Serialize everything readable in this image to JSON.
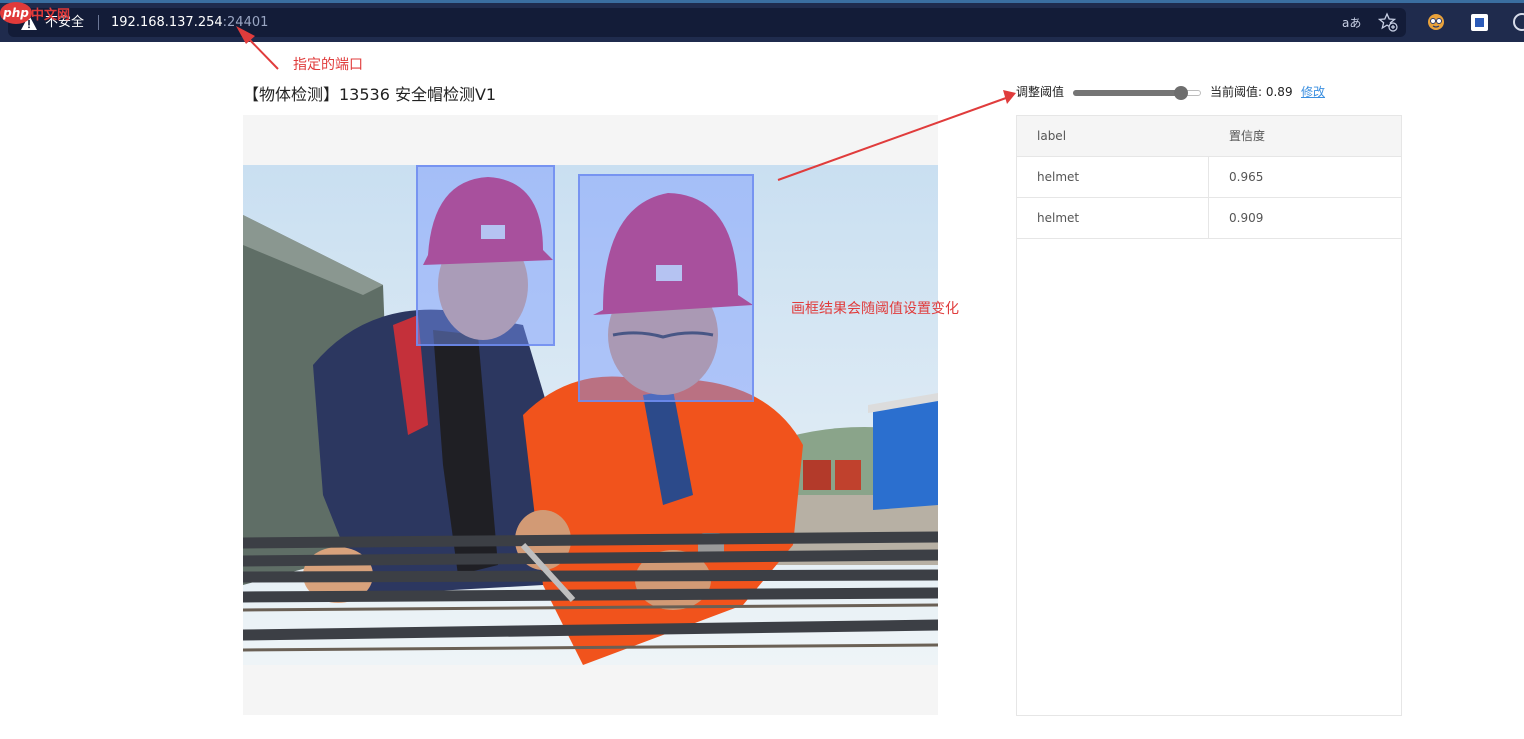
{
  "browser": {
    "security_label": "不安全",
    "url_host": "192.168.137.254",
    "url_port": ":24401",
    "read_aloud_label": "aあ",
    "icons": {
      "warning": "warning-triangle-icon",
      "favorites": "star-add-icon",
      "extension1": "face-extension-icon",
      "extension2": "blue-square-extension-icon",
      "settings": "gear-icon"
    }
  },
  "watermark": {
    "badge": "php",
    "text": "中文网"
  },
  "page": {
    "title": "【物体检测】13536 安全帽检测V1",
    "threshold_label": "调整阈值",
    "threshold_value": 0.89,
    "current_label": "当前阈值: 0.89",
    "modify_label": "修改"
  },
  "detections": [
    {
      "label": "helmet",
      "score": "0.965"
    },
    {
      "label": "helmet",
      "score": "0.909"
    }
  ],
  "table": {
    "headers": [
      "label",
      "置信度"
    ],
    "rows": [
      [
        "helmet",
        "0.965"
      ],
      [
        "helmet",
        "0.909"
      ]
    ]
  },
  "annotations": {
    "port_note": "指定的端口",
    "bbox_note": "画框结果会随阈值设置变化"
  },
  "colors": {
    "annotation": "#e03c3c",
    "link": "#3b8fe0",
    "bbox_fill": "rgba(120,150,255,0.45)",
    "chrome": "#1f2b4d"
  }
}
